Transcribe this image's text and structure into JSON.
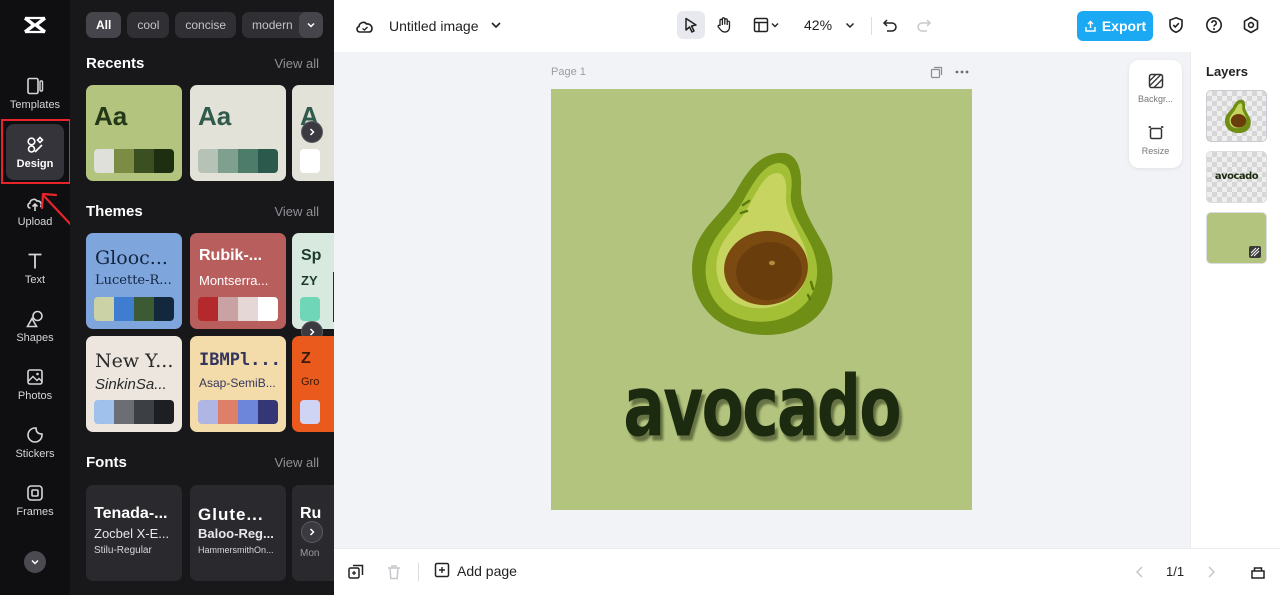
{
  "rail": {
    "items": [
      {
        "label": "Templates",
        "icon": "templates-icon"
      },
      {
        "label": "Design",
        "icon": "design-icon",
        "active": true
      },
      {
        "label": "Upload",
        "icon": "upload-icon"
      },
      {
        "label": "Text",
        "icon": "text-icon"
      },
      {
        "label": "Shapes",
        "icon": "shapes-icon"
      },
      {
        "label": "Photos",
        "icon": "photos-icon"
      },
      {
        "label": "Stickers",
        "icon": "stickers-icon"
      },
      {
        "label": "Frames",
        "icon": "frames-icon"
      }
    ],
    "highlight_color": "#e8242b"
  },
  "panel": {
    "chips": [
      "All",
      "cool",
      "concise",
      "modern"
    ],
    "recents": {
      "title": "Recents",
      "view_all": "View all",
      "cards": [
        {
          "sample": "Aa",
          "bg": "#b3c47e",
          "fg": "#243818",
          "swatches": [
            "#dfe0d9",
            "#7d8c44",
            "#3b4f21",
            "#1e2e11"
          ]
        },
        {
          "sample": "Aa",
          "bg": "#e2e2d8",
          "fg": "#2f5a4c",
          "swatches": [
            "#b7c2b7",
            "#7f9f8f",
            "#4d7c6a",
            "#2b5a4c"
          ]
        },
        {
          "sample": "A",
          "bg": "#e2e2d8",
          "fg": "#2f5a4c",
          "swatches": [
            "#ffffff"
          ]
        }
      ]
    },
    "themes": {
      "title": "Themes",
      "view_all": "View all",
      "cards": [
        {
          "title": "Glooc...",
          "sub": "Lucette-R...",
          "bg": "#7ea6dd",
          "fg": "#13243f",
          "swatches": [
            "#cbd3a6",
            "#3f7dd0",
            "#3c5a33",
            "#14283d"
          ]
        },
        {
          "title": "Rubik-...",
          "sub": "Montserra...",
          "bg": "#b85f5e",
          "fg": "#ffffff",
          "swatches": [
            "#b42a2c",
            "#c9a3a3",
            "#e4d7d6",
            "#ffffff"
          ]
        },
        {
          "title": "Sp",
          "sub": "ZY",
          "bg": "#d8eadf",
          "fg": "#1d3a2d",
          "swatches": [
            "#6fd6b7"
          ]
        },
        {
          "title": "New Y...",
          "sub": "SinkinSa...",
          "bg": "#ece6de",
          "fg": "#2a2a2a",
          "swatches": [
            "#9fc1ec",
            "#6b6f75",
            "#3c3f44",
            "#1d1f23"
          ]
        },
        {
          "title": "IBMPl...",
          "sub": "Asap-SemiB...",
          "bg": "#f4dcaa",
          "fg": "#34365e",
          "swatches": [
            "#b0b6e4",
            "#de8068",
            "#6e86d9",
            "#343676"
          ]
        },
        {
          "title": "Z",
          "sub": "Gro",
          "bg": "#ea5a1c",
          "fg": "#3a1a08",
          "swatches": [
            "#cfd4f4"
          ]
        }
      ]
    },
    "fonts": {
      "title": "Fonts",
      "view_all": "View all",
      "cards": [
        {
          "l1": "Tenada-...",
          "l2": "Zocbel X-E...",
          "l3": "Stilu-Regular"
        },
        {
          "l1": "Glute...",
          "l2": "Baloo-Reg...",
          "l3": "HammersmithOn..."
        },
        {
          "l1": "Ru",
          "l2": "",
          "l3": "Mon"
        }
      ]
    }
  },
  "topbar": {
    "doc_title": "Untitled image",
    "zoom": "42%",
    "export_label": "Export",
    "accent": "#1aa9f2"
  },
  "canvas": {
    "page_label": "Page 1",
    "artboard_bg": "#b3c47e",
    "headline": "avocado",
    "floating_tools": [
      "Backgr...",
      "Resize"
    ]
  },
  "layers": {
    "title": "Layers"
  },
  "bottom": {
    "add_page_label": "Add page",
    "page_count": "1/1"
  }
}
